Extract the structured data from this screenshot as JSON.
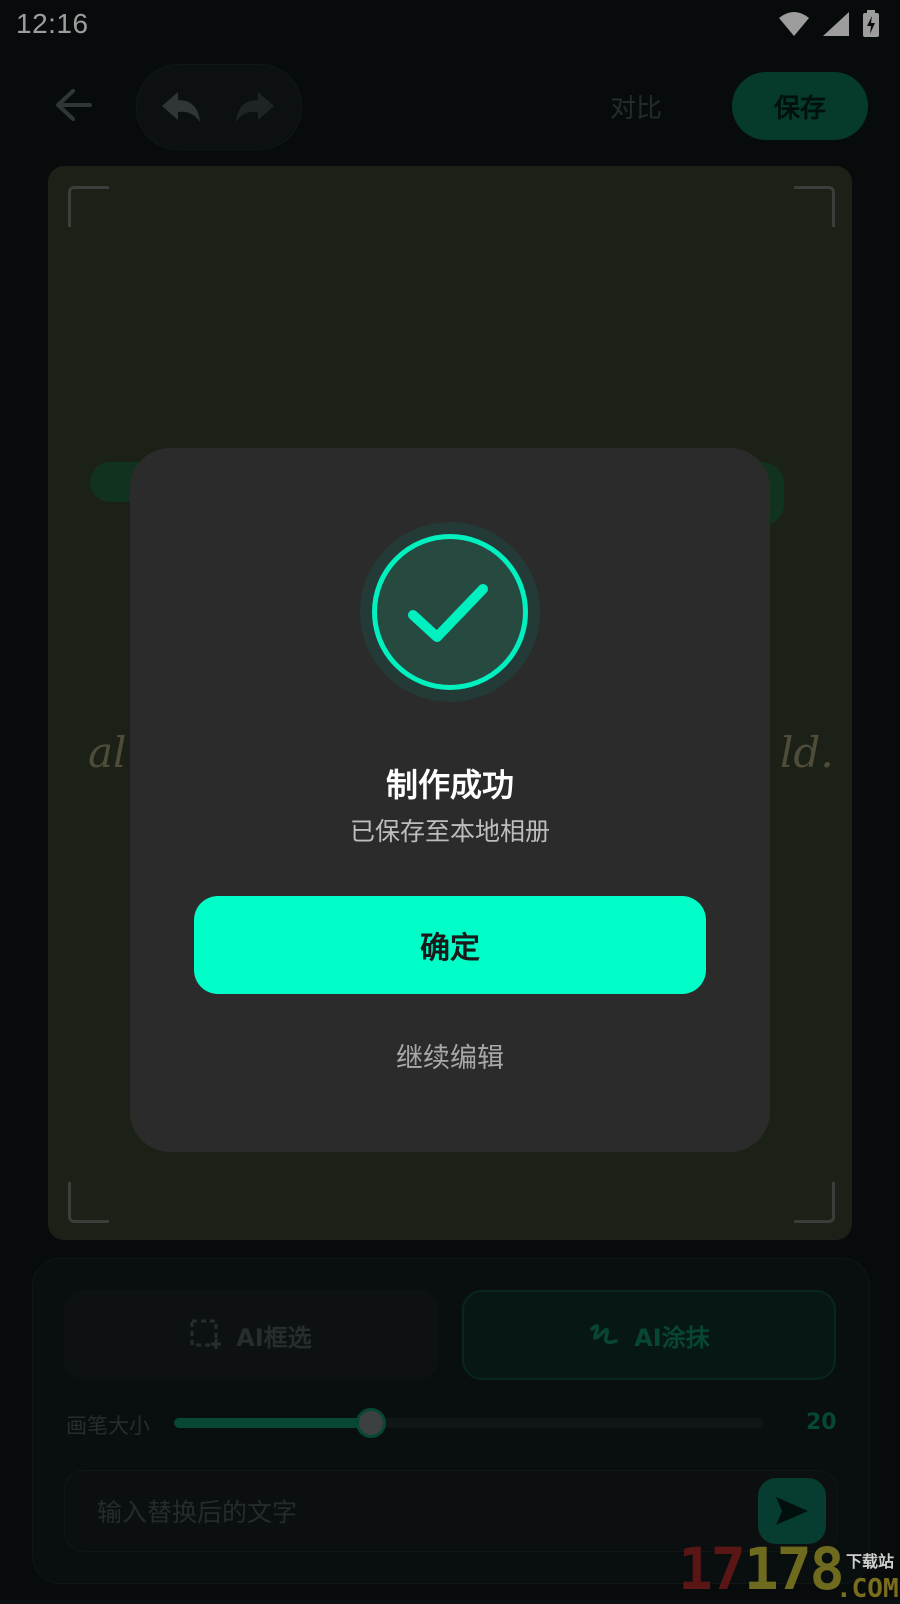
{
  "status_bar": {
    "time": "12:16"
  },
  "toolbar": {
    "compare_label": "对比",
    "save_label": "保存"
  },
  "canvas": {
    "hand_left": "al",
    "hand_right": "ld."
  },
  "tools": {
    "select_label": "AI框选",
    "brush_label": "AI涂抹"
  },
  "brush": {
    "label": "画笔大小",
    "value": "20",
    "level_fraction": 0.33
  },
  "input": {
    "placeholder": "输入替换后的文字"
  },
  "dialog": {
    "title": "制作成功",
    "subtitle": "已保存至本地相册",
    "confirm_label": "确定",
    "continue_label": "继续编辑"
  },
  "watermark": {
    "digits_a": "17",
    "digits_b": "178",
    "sub": "下载站",
    "com": ".COM"
  },
  "colors": {
    "accent": "#00ffc8",
    "dialog_bg": "#2b2b2b",
    "page_bg": "#0c1112"
  }
}
